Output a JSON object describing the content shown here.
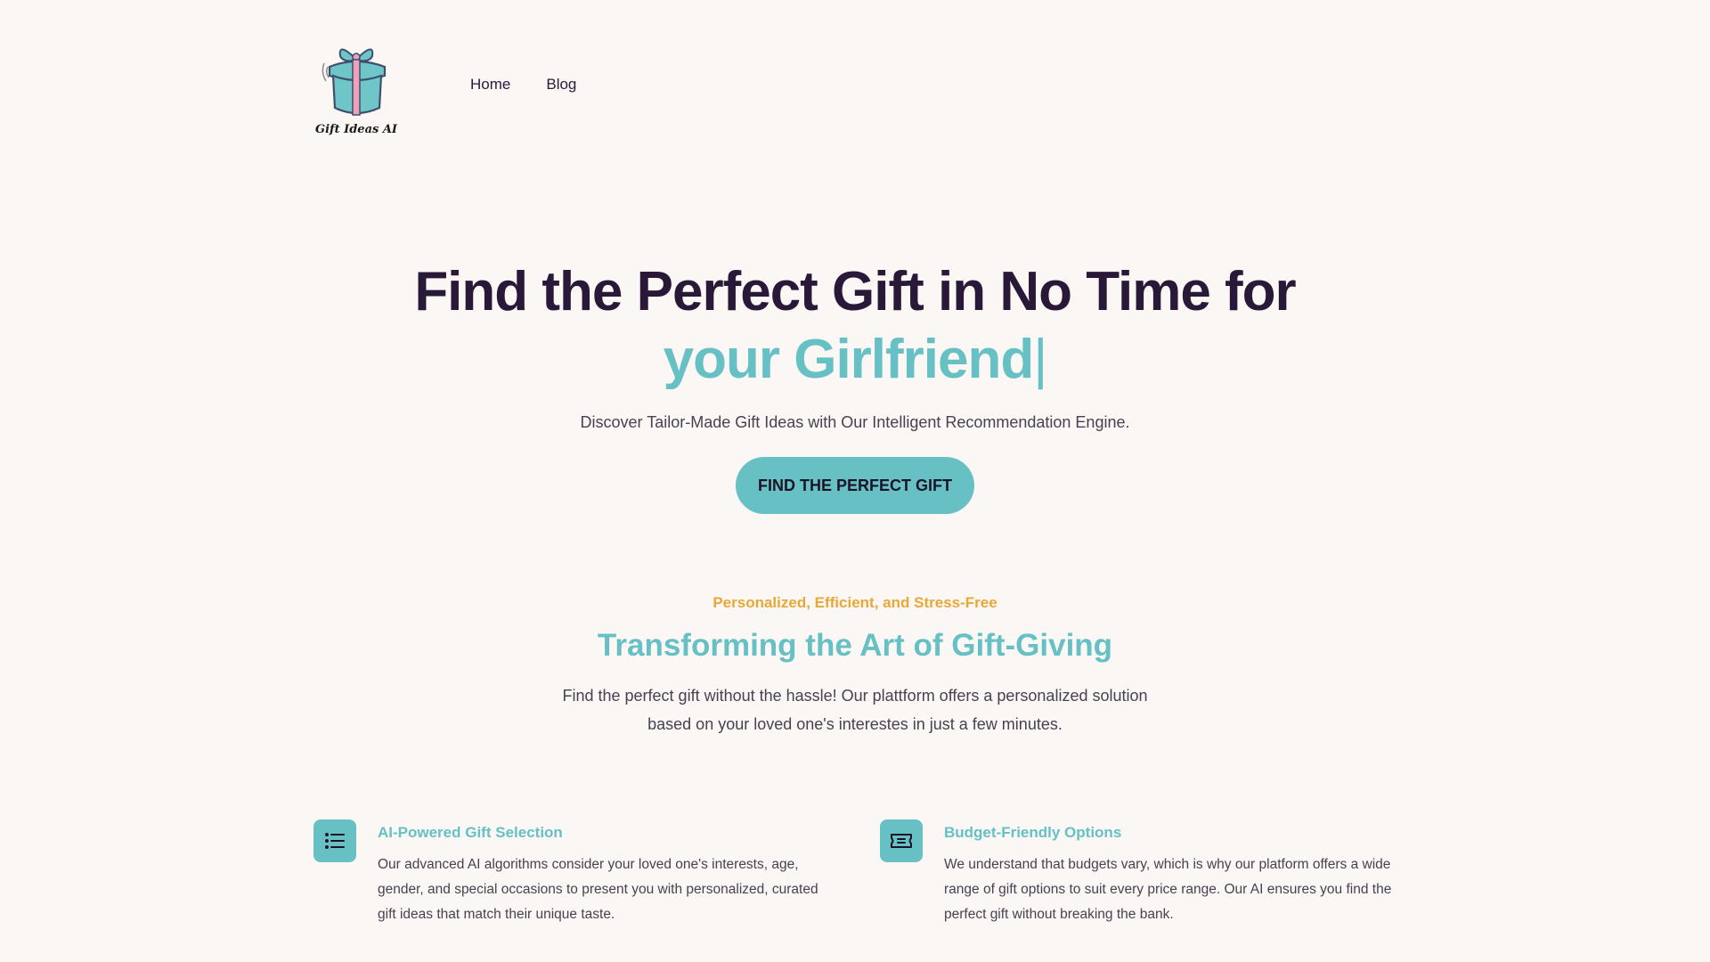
{
  "header": {
    "logo_text": "Gift Ideas AI",
    "nav": [
      {
        "label": "Home"
      },
      {
        "label": "Blog"
      }
    ]
  },
  "hero": {
    "title_line1": "Find the Perfect Gift in No Time for",
    "title_line2": "your Girlfriend",
    "cursor": "|",
    "subtitle": "Discover Tailor-Made Gift Ideas with Our Intelligent Recommendation Engine.",
    "cta_label": "FIND THE PERFECT GIFT"
  },
  "features_intro": {
    "eyebrow": "Personalized, Efficient, and Stress-Free",
    "title": "Transforming the Art of Gift-Giving",
    "description": "Find the perfect gift without the hassle! Our plattform offers a personalized solution based on your loved one's interestes in just a few minutes."
  },
  "features": [
    {
      "icon": "list-icon",
      "title": "AI-Powered Gift Selection",
      "text": "Our advanced AI algorithms consider your loved one's interests, age, gender, and special occasions to present you with personalized, curated gift ideas that match their unique taste."
    },
    {
      "icon": "ticket-icon",
      "title": "Budget-Friendly Options",
      "text": "We understand that budgets vary, which is why our platform offers a wide range of gift options to suit every price range. Our AI ensures you find the perfect gift without breaking the bank."
    }
  ],
  "colors": {
    "background": "#faf7f5",
    "accent": "#66c0c4",
    "heading_dark": "#2a1838",
    "eyebrow": "#e8a838",
    "body_text": "#4a4050"
  }
}
